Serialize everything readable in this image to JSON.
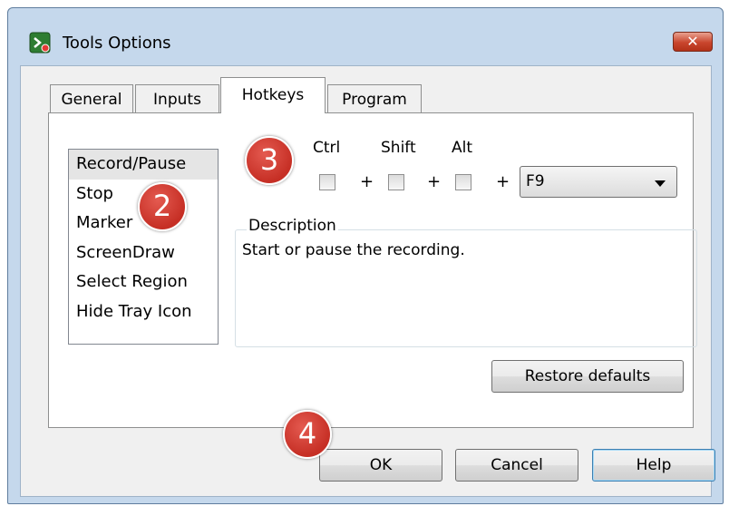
{
  "window": {
    "title": "Tools Options",
    "close_glyph": "✕",
    "icon": "app-icon"
  },
  "tabs": [
    {
      "label": "General",
      "active": false
    },
    {
      "label": "Inputs",
      "active": false
    },
    {
      "label": "Hotkeys",
      "active": true
    },
    {
      "label": "Program",
      "active": false
    }
  ],
  "hotkey_list": {
    "items": [
      "Record/Pause",
      "Stop",
      "Marker",
      "ScreenDraw",
      "Select Region",
      "Hide Tray Icon"
    ],
    "selected": "Record/Pause"
  },
  "modifiers": {
    "ctrl": "Ctrl",
    "shift": "Shift",
    "alt": "Alt",
    "plus": "+"
  },
  "key_select": {
    "value": "F9"
  },
  "description": {
    "legend": "Description",
    "text": "Start or pause the recording."
  },
  "buttons": {
    "restore": "Restore defaults",
    "ok": "OK",
    "cancel": "Cancel",
    "help": "Help"
  },
  "badges": {
    "b2": "2",
    "b3": "3",
    "b4": "4"
  },
  "colors": {
    "badge": "#d2372c",
    "selection": "#e5e5e5",
    "close": "#c9452d"
  }
}
